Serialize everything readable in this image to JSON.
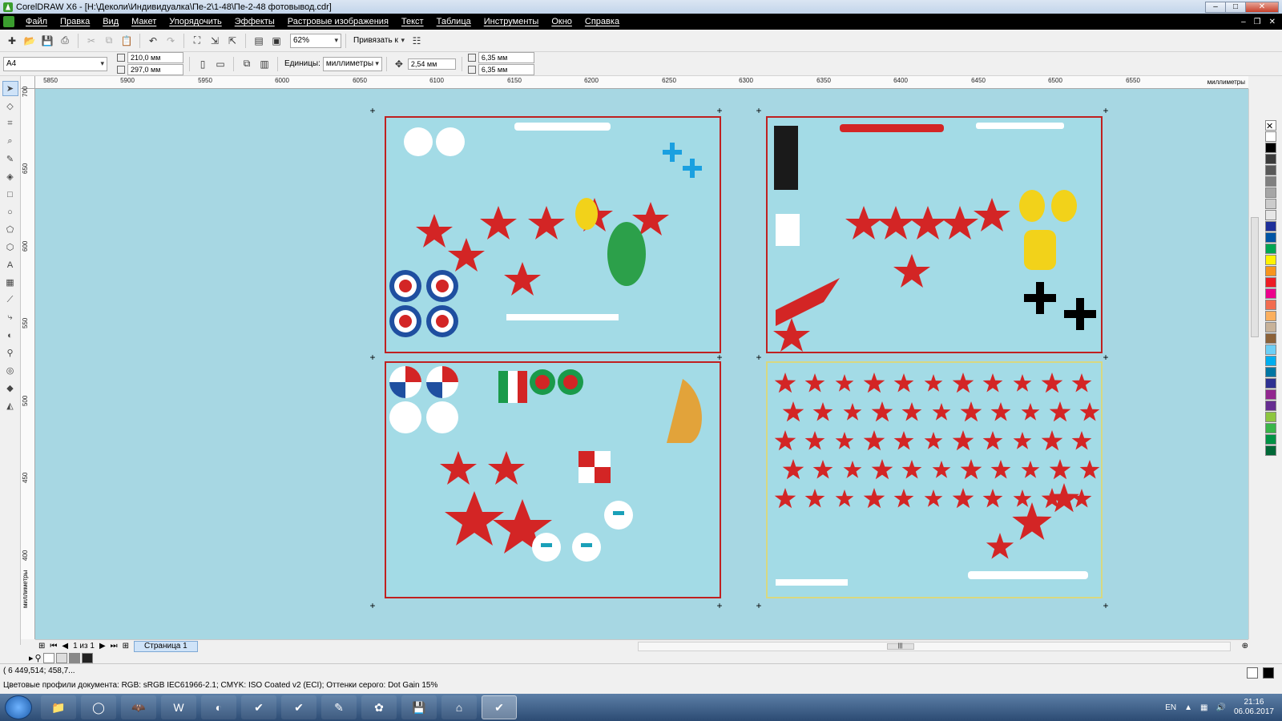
{
  "window": {
    "title": "CorelDRAW X6 - [H:\\Деколи\\Индивидуалка\\Пе-2\\1-48\\Пе-2-48 фотовывод.cdr]"
  },
  "menu": {
    "items": [
      "Файл",
      "Правка",
      "Вид",
      "Макет",
      "Упорядочить",
      "Эффекты",
      "Растровые изображения",
      "Текст",
      "Таблица",
      "Инструменты",
      "Окно",
      "Справка"
    ]
  },
  "toolbar": {
    "zoom": "62%",
    "snap_label": "Привязать к"
  },
  "propertybar": {
    "page_size": "A4",
    "width": "210,0 мм",
    "height": "297,0 мм",
    "units_label": "Единицы:",
    "units_value": "миллиметры",
    "nudge": "2,54 мм",
    "dup_x": "6,35 мм",
    "dup_y": "6,35 мм"
  },
  "ruler": {
    "h_labels": [
      "5850",
      "5900",
      "5950",
      "6000",
      "6050",
      "6100",
      "6150",
      "6200",
      "6250",
      "6300",
      "6350",
      "6400",
      "6450",
      "6500",
      "6550"
    ],
    "h_unit": "миллиметры",
    "v_labels": [
      "700",
      "650",
      "600",
      "550",
      "500",
      "450",
      "400"
    ],
    "v_unit": "миллиметры"
  },
  "pages": {
    "counter": "1 из 1",
    "tab_label": "Страница 1"
  },
  "status": {
    "coords": "( 6 449,514; 458,7...",
    "profile": "Цветовые профили документа: RGB: sRGB IEC61966-2.1; CMYK: ISO Coated v2 (ECI); Оттенки серого: Dot Gain 15%"
  },
  "palette_colors": [
    "#ffffff",
    "#000000",
    "#3b3b3b",
    "#595959",
    "#808080",
    "#a6a6a6",
    "#cccccc",
    "#e6e6e6",
    "#1e2f9a",
    "#0055a5",
    "#00a651",
    "#fff200",
    "#f7941d",
    "#ed1c24",
    "#ec008c",
    "#f26c4f",
    "#fbaf5d",
    "#c7b299",
    "#8c6239",
    "#6dcff6",
    "#00aeef",
    "#0076a3",
    "#2e3192",
    "#92278f",
    "#662d91",
    "#8dc63f",
    "#39b54a",
    "#009245",
    "#006837"
  ],
  "taskbar": {
    "lang": "EN",
    "time": "21:16",
    "date": "06.06.2017"
  }
}
